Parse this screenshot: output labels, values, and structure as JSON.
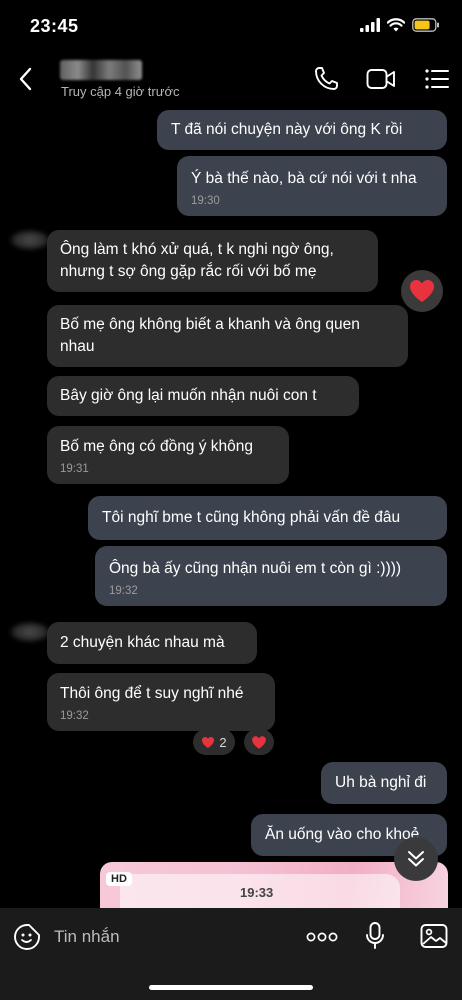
{
  "status": {
    "time": "23:45"
  },
  "header": {
    "subtitle": "Truy cập 4 giờ trước"
  },
  "messages": [
    {
      "dir": "out",
      "text": "T đã nói chuyện này với ông K rồi"
    },
    {
      "dir": "out",
      "text": "Ý bà thế nào, bà cứ nói với t nha",
      "time": "19:30"
    },
    {
      "dir": "in",
      "text": "Ông làm t khó xử quá, t k nghi ngờ ông, nhưng t sợ ông gặp rắc rối với bố mẹ"
    },
    {
      "dir": "in",
      "text": "Bố mẹ ông không biết a khanh và ông quen nhau"
    },
    {
      "dir": "in",
      "text": "Bây giờ ông lại muốn nhận nuôi con t"
    },
    {
      "dir": "in",
      "text": "Bố mẹ ông có đồng ý không",
      "time": "19:31"
    },
    {
      "dir": "out",
      "text": "Tôi nghĩ bme t cũng không phải vấn đề đâu"
    },
    {
      "dir": "out",
      "text": "Ông bà ấy cũng nhận nuôi em t còn gì :))))",
      "time": "19:32"
    },
    {
      "dir": "in",
      "text": "2 chuyện khác nhau mà"
    },
    {
      "dir": "in",
      "text": "Thôi ông để t suy nghĩ nhé",
      "time": "19:32"
    },
    {
      "dir": "out",
      "text": "Uh bà nghỉ đi"
    },
    {
      "dir": "out",
      "text": "Ăn uống vào cho khoẻ"
    }
  ],
  "reactions": {
    "heart_count": "2"
  },
  "image_message": {
    "badge": "HD",
    "time": "19:33"
  },
  "composer": {
    "placeholder": "Tin nhắn"
  },
  "colors": {
    "incoming": "#2d2d2e",
    "outgoing": "#3d434e",
    "battery": "#f5c518",
    "heart": "#e8333f"
  }
}
